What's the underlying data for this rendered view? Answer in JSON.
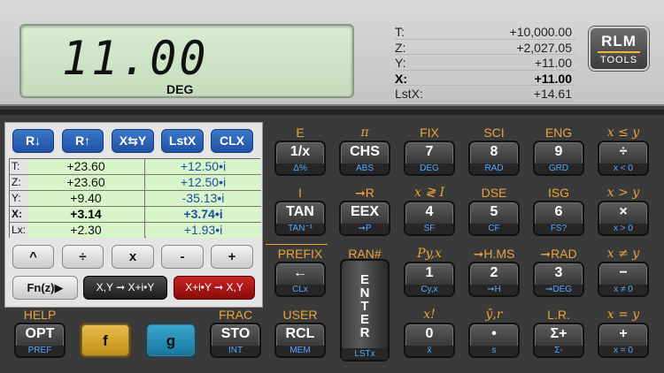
{
  "display": {
    "value": "11.00",
    "mode": "DEG"
  },
  "stack": [
    {
      "label": "T:",
      "value": "+10,000.00"
    },
    {
      "label": "Z:",
      "value": "+2,027.05"
    },
    {
      "label": "Y:",
      "value": "+11.00"
    },
    {
      "label": "X:",
      "value": "+11.00"
    },
    {
      "label": "LstX:",
      "value": "+14.61"
    }
  ],
  "logo": {
    "line1": "RLM",
    "line2": "TOOLS"
  },
  "complex": {
    "top_buttons": [
      "R↓",
      "R↑",
      "X⇆Y",
      "LstX",
      "CLX"
    ],
    "rows": [
      {
        "label": "T:",
        "re": "+23.60",
        "im": "+12.50•i"
      },
      {
        "label": "Z:",
        "re": "+23.60",
        "im": "+12.50•i"
      },
      {
        "label": "Y:",
        "re": "+9.40",
        "im": "-35.13•i"
      },
      {
        "label": "X:",
        "re": "+3.14",
        "im": "+3.74•i"
      },
      {
        "label": "Lx:",
        "re": "+2.30",
        "im": "+1.93•i"
      }
    ],
    "ops": [
      "^",
      "÷",
      "x",
      "-",
      "+"
    ],
    "fn": "Fn(z)▶",
    "to_complex": "X,Y ➞ X+i•Y",
    "to_pair": "X+i•Y ➞ X,Y"
  },
  "keys": {
    "r1": [
      {
        "top": "E",
        "main": "1/x",
        "bot": "Δ%"
      },
      {
        "top": "π",
        "main": "CHS",
        "bot": "ABS"
      },
      {
        "top": "FIX",
        "main": "7",
        "bot": "DEG"
      },
      {
        "top": "SCI",
        "main": "8",
        "bot": "RAD"
      },
      {
        "top": "ENG",
        "main": "9",
        "bot": "GRD"
      },
      {
        "top": "x ≤ y",
        "main": "÷",
        "bot": "x < 0"
      }
    ],
    "r2": [
      {
        "top": "I",
        "main": "TAN",
        "bot": "TAN⁻¹"
      },
      {
        "top": "➞R",
        "main": "EEX",
        "bot": "➞P"
      },
      {
        "top": "x ≷ I",
        "main": "4",
        "bot": "SF"
      },
      {
        "top": "DSE",
        "main": "5",
        "bot": "CF"
      },
      {
        "top": "ISG",
        "main": "6",
        "bot": "FS?"
      },
      {
        "top": "x > y",
        "main": "×",
        "bot": "x > 0"
      }
    ],
    "r3": [
      {
        "top": "PREFIX",
        "main": "←",
        "bot": "CLx"
      },
      {
        "top": "RAN#",
        "main": "",
        "bot": ""
      },
      {
        "top": "Py,x",
        "main": "1",
        "bot": "Cy,x"
      },
      {
        "top": "➞H.MS",
        "main": "2",
        "bot": "➞H"
      },
      {
        "top": "➞RAD",
        "main": "3",
        "bot": "➞DEG"
      },
      {
        "top": "x ≠ y",
        "main": "−",
        "bot": "x ≠ 0"
      }
    ],
    "r4": [
      {
        "top": "HELP",
        "main": "OPT",
        "bot": "PREF"
      },
      {
        "top": "",
        "main": "f",
        "bot": ""
      },
      {
        "top": "",
        "main": "g",
        "bot": ""
      },
      {
        "top": "FRAC",
        "main": "STO",
        "bot": "INT"
      },
      {
        "top": "USER",
        "main": "RCL",
        "bot": "MEM"
      },
      {
        "top": "x!",
        "main": "0",
        "bot": "x̄"
      },
      {
        "top": "ŷ,r",
        "main": "•",
        "bot": "s"
      },
      {
        "top": "L.R.",
        "main": "Σ+",
        "bot": "Σ-"
      },
      {
        "top": "x = y",
        "main": "+",
        "bot": "x = 0"
      }
    ],
    "enter": {
      "main": "E\nN\nT\nE\nR",
      "bot": "LSTx"
    }
  }
}
